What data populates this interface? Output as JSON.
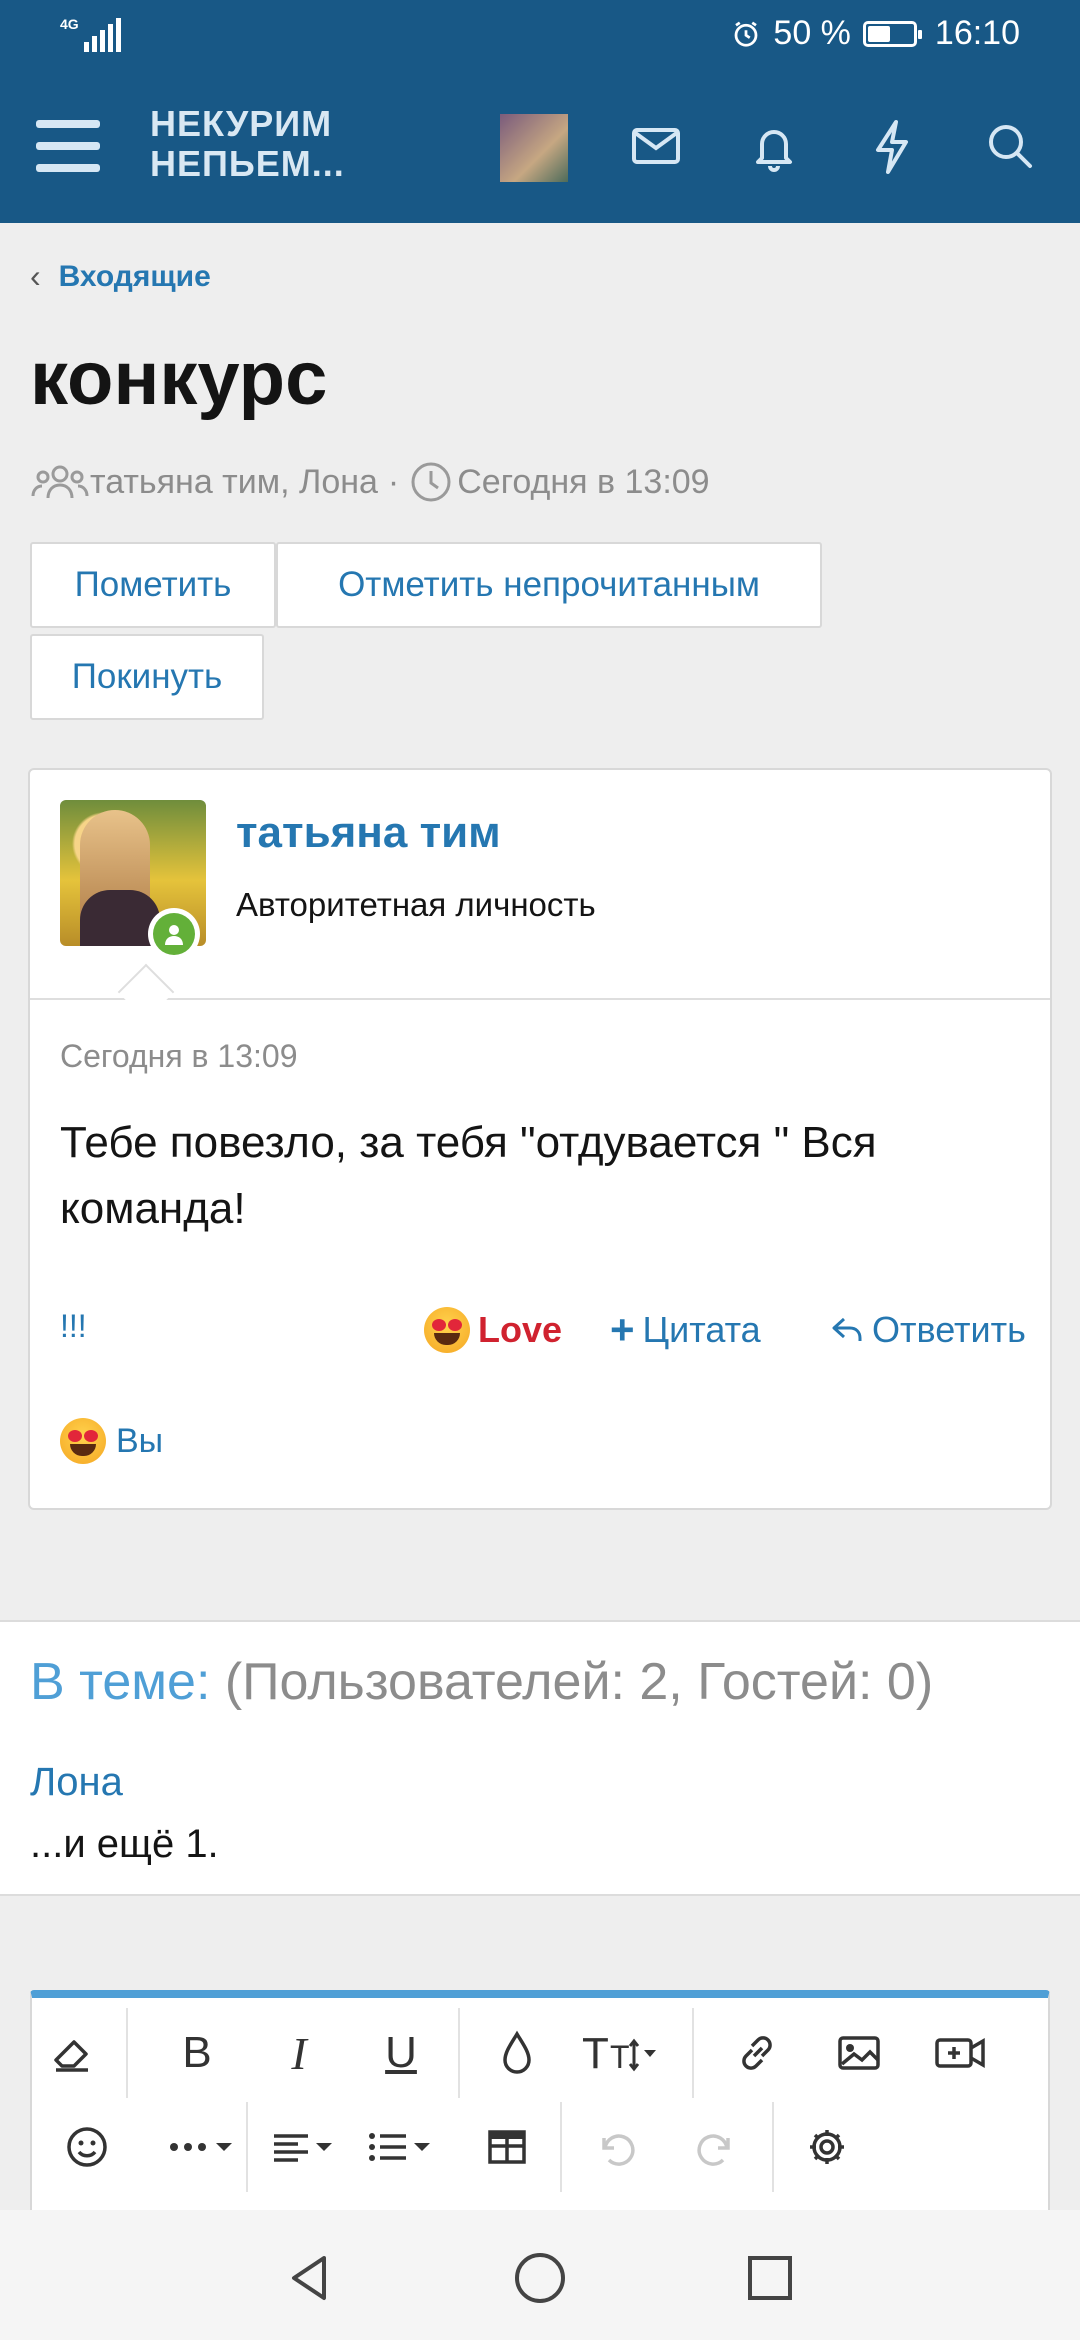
{
  "status": {
    "network": "4G",
    "battery": "50 %",
    "time": "16:10"
  },
  "app": {
    "logo_line1": "НЕКУРИМ",
    "logo_line2": "НЕПЬЕМ..."
  },
  "icons": {
    "menu": "hamburger-icon",
    "mail": "envelope-icon",
    "bell": "bell-icon",
    "bolt": "lightning-icon",
    "search": "search-icon"
  },
  "breadcrumb": {
    "label": "Входящие"
  },
  "conversation": {
    "title": "конкурс",
    "participants": "татьяна тим, Лона",
    "separator": "·",
    "date": "Сегодня в 13:09"
  },
  "buttons": {
    "mark": "Пометить",
    "mark_unread": "Отметить непрочитанным",
    "leave": "Покинуть"
  },
  "message": {
    "author": "татьяна тим",
    "role": "Авторитетная личность",
    "date": "Сегодня в 13:09",
    "text": "Тебе повезло, за тебя \"отдувается \" Вся команда!",
    "report": "!!!",
    "love": "Love",
    "quote": "Цитата",
    "reply": "Ответить",
    "reaction_by": "Вы"
  },
  "online": {
    "label": "В теме:",
    "counts": "(Пользователей: 2, Гостей: 0)",
    "user": "Лона",
    "more": "...и ещё 1."
  },
  "colors": {
    "header": "#185886",
    "link": "#2577b1",
    "accent": "#4f9fd6",
    "love": "#d0222f",
    "online": "#63b039"
  }
}
